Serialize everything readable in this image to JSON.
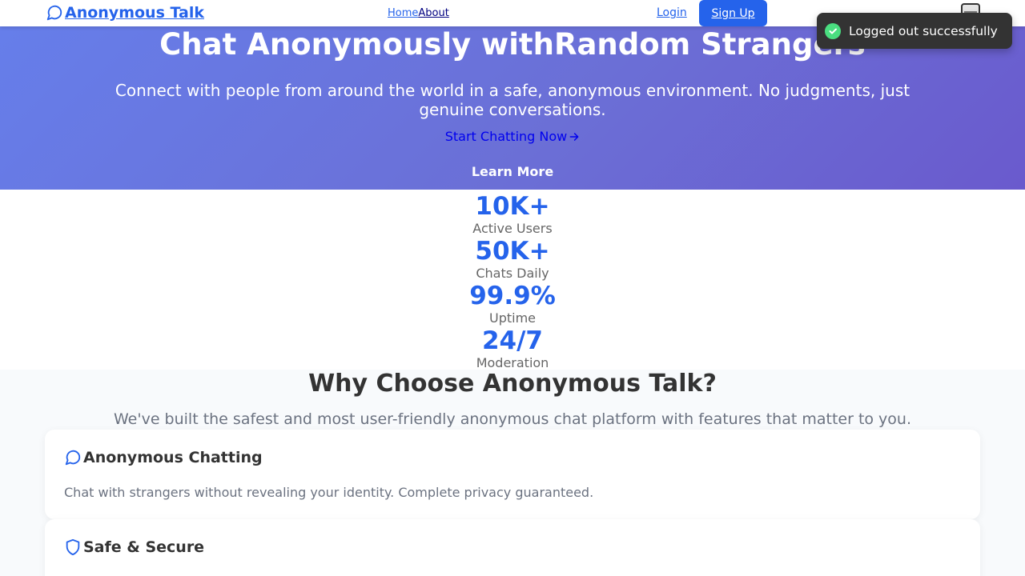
{
  "header": {
    "brand": "Anonymous Talk",
    "nav": {
      "home": "Home",
      "about": "About"
    },
    "login": "Login",
    "signup": "Sign Up"
  },
  "toast": {
    "message": "Logged out successfully"
  },
  "hero": {
    "title": "Chat Anonymously withRandom Strangers",
    "subtitle": "Connect with people from around the world in a safe, anonymous environment. No judgments, just genuine conversations.",
    "start": "Start Chatting Now",
    "learn": "Learn More"
  },
  "stats": [
    {
      "value": "10K+",
      "label": "Active Users"
    },
    {
      "value": "50K+",
      "label": "Chats Daily"
    },
    {
      "value": "99.9%",
      "label": "Uptime"
    },
    {
      "value": "24/7",
      "label": "Moderation"
    }
  ],
  "features": {
    "title": "Why Choose Anonymous Talk?",
    "subtitle": "We've built the safest and most user-friendly anonymous chat platform with features that matter to you.",
    "cards": [
      {
        "icon": "chat-bubble-icon",
        "title": "Anonymous Chatting",
        "desc": "Chat with strangers without revealing your identity. Complete privacy guaranteed."
      },
      {
        "icon": "shield-icon",
        "title": "Safe & Secure",
        "desc": ""
      }
    ]
  },
  "colors": {
    "accent": "#2563eb",
    "toast_bg": "#333333",
    "toast_check": "#4ade80"
  }
}
